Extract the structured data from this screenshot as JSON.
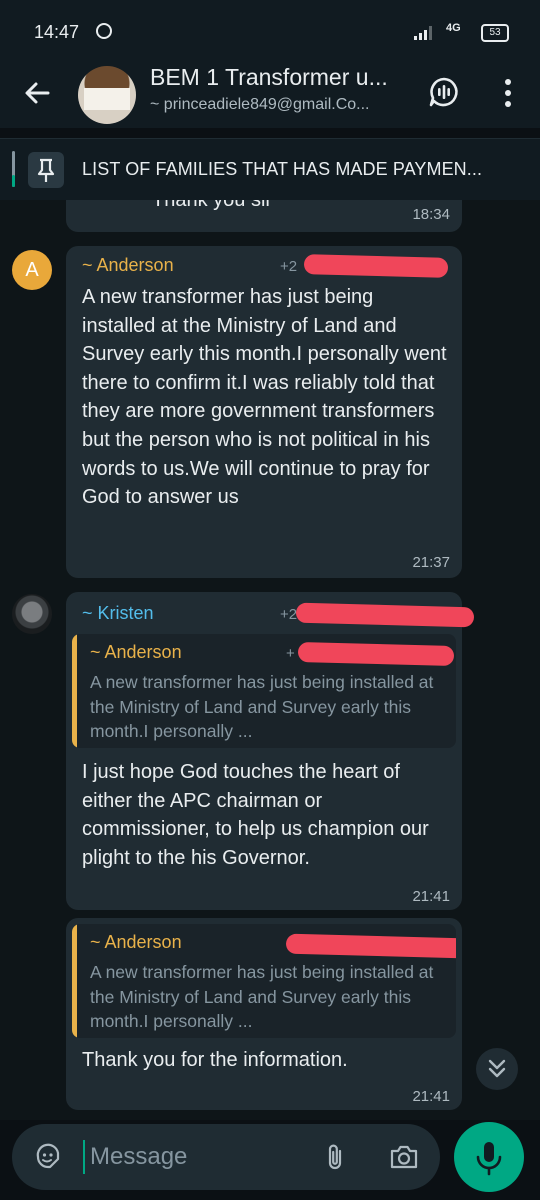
{
  "status_bar": {
    "time": "14:47",
    "network": "4G",
    "battery": "53"
  },
  "header": {
    "title": "BEM 1 Transformer u...",
    "subtitle": "~ princeadiele849@gmail.Co..."
  },
  "pinned": {
    "text": "LIST OF FAMILIES THAT HAS MADE PAYMEN..."
  },
  "messages": [
    {
      "text": "Thank you sir",
      "time": "18:34"
    },
    {
      "avatar_letter": "A",
      "sender": "~ Anderson",
      "sender_color": "#e9b24a",
      "phone_prefix": "+2",
      "text": "A new transformer has just being installed at the Ministry of Land and Survey early this month.I personally went there to confirm it.I was  reliably told that they are more government transformers but the person who is not political in his words to us.We will continue to pray for God to answer us",
      "time": "21:37"
    },
    {
      "sender": "~ Kristen",
      "sender_color": "#53bdeb",
      "phone_prefix": "+2",
      "quote": {
        "sender": "~ Anderson",
        "phone_prefix": "+",
        "text": "A new transformer has just being installed at the Ministry of Land and Survey early this month.I personally ..."
      },
      "text": "I just hope God touches the heart of either the APC chairman or commissioner, to help us champion our plight to the his Governor.",
      "time": "21:41"
    },
    {
      "quote": {
        "sender": "~ Anderson",
        "text": "A new transformer has just being installed at the Ministry of Land and Survey early this month.I personally ..."
      },
      "text": "Thank you for the information.",
      "time": "21:41"
    }
  ],
  "input": {
    "placeholder": "Message"
  },
  "colors": {
    "accent": "#00a884",
    "bubble": "#202c33",
    "background": "#0b1014"
  }
}
